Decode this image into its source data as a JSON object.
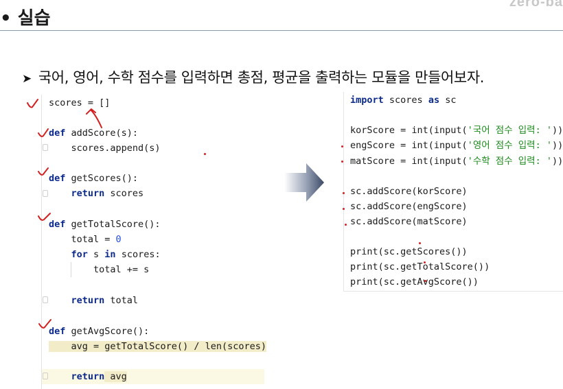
{
  "header": {
    "title": "• 실습",
    "brand": "zero-ba"
  },
  "task": {
    "arrow": "➤",
    "text": "국어, 영어, 수학 점수를 입력하면 총점, 평균을 출력하는 모듈을 만들어보자."
  },
  "module_code": {
    "l1": {
      "a": "scores = []"
    },
    "l2": {
      "kw": "def",
      "rest": " addScore(s):"
    },
    "l3": {
      "a": "    scores.append(s)"
    },
    "l4": {
      "kw": "def",
      "rest": " getScores():"
    },
    "l5": {
      "kw": "    return",
      "rest": " scores"
    },
    "l6": {
      "kw": "def",
      "rest": " getTotalScore():"
    },
    "l7": {
      "a": "    total = ",
      "num": "0"
    },
    "l8": {
      "kw1": "    for",
      "mid": " s ",
      "kw2": "in",
      "rest": " scores:"
    },
    "l9": {
      "a": "        total += s"
    },
    "l10": {
      "kw": "    return",
      "rest": " total"
    },
    "l11": {
      "kw": "def",
      "rest": " getAvgScore():"
    },
    "l12": {
      "a": "    avg = getTotalScore() / len(scores)"
    },
    "l13": {
      "kw": "    return",
      "rest": " avg"
    }
  },
  "main_code": {
    "r1": {
      "kw1": "import",
      "mid": " scores ",
      "kw2": "as",
      "rest": " sc"
    },
    "r2": {
      "a": "korScore = int(input(",
      "str": "'국어 점수 입력: '",
      "b": "))"
    },
    "r3": {
      "a": "engScore = int(input(",
      "str": "'영어 점수 입력: '",
      "b": "))"
    },
    "r4": {
      "a": "matScore = int(input(",
      "str": "'수학 점수 입력: '",
      "b": "))"
    },
    "r5": {
      "a": "sc.addScore(korScore)"
    },
    "r6": {
      "a": "sc.addScore(engScore)"
    },
    "r7": {
      "a": "sc.addScore(matScore)"
    },
    "r8": {
      "a": "print(sc.getScores())"
    },
    "r9": {
      "a": "print(sc.getTotalScore())"
    },
    "r10": {
      "a": "print(sc.getAvgScore())"
    }
  },
  "colors": {
    "keyword": "#0b2a8c",
    "number": "#1f4fe0",
    "string": "#1a8a1a",
    "annotation": "#d21f1f"
  }
}
